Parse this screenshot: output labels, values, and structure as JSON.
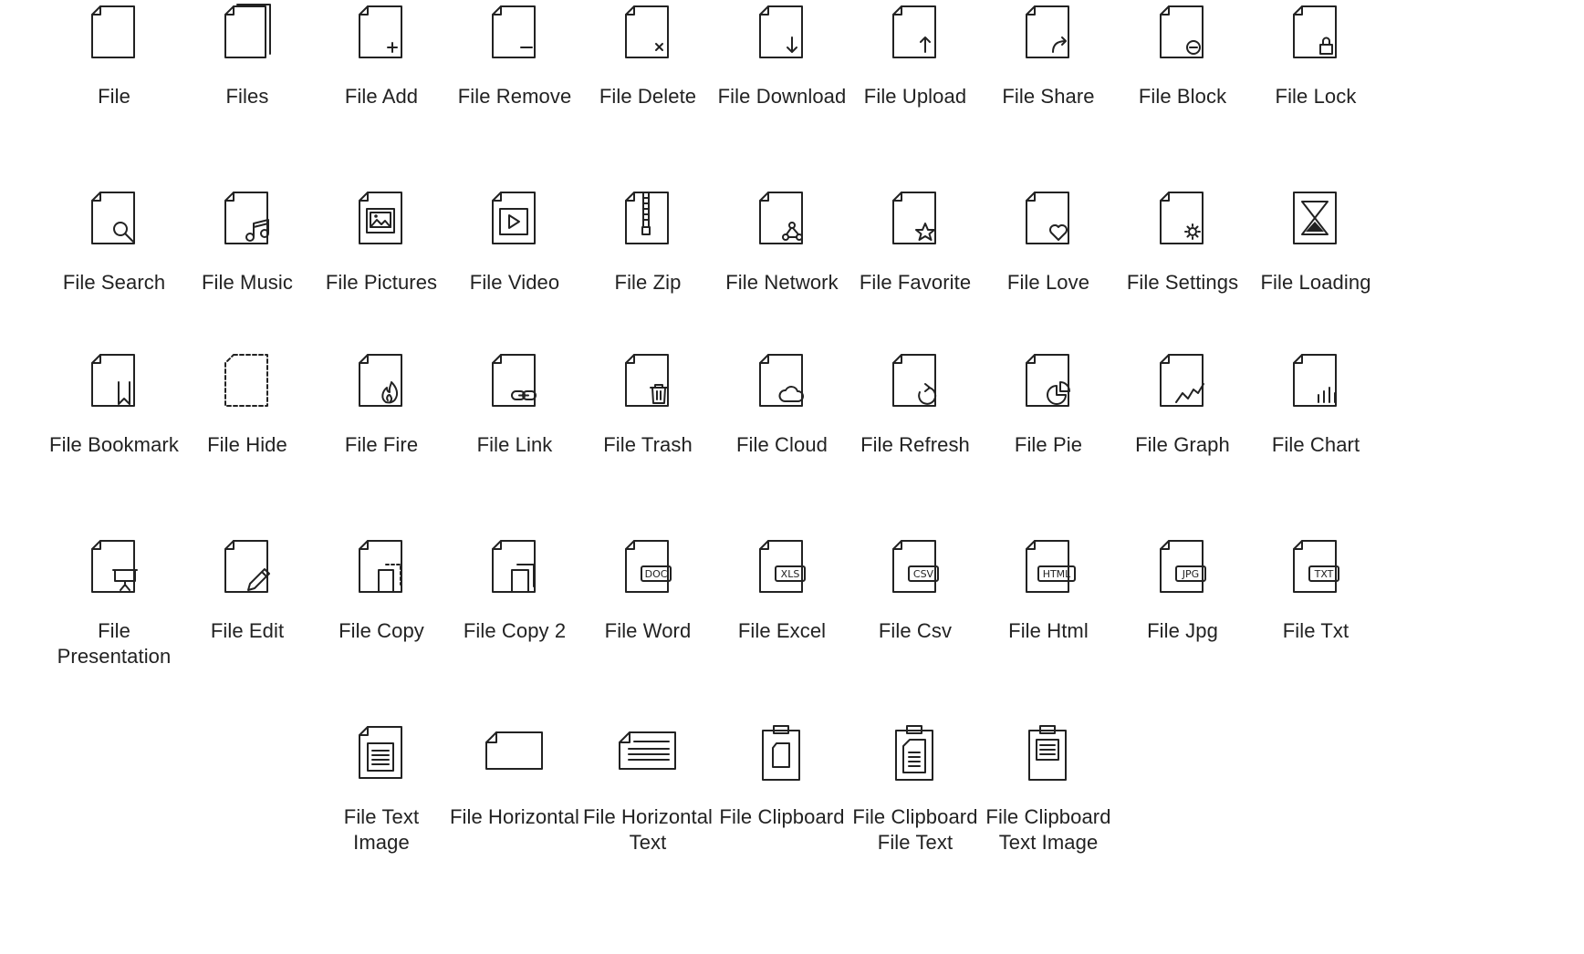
{
  "colors": {
    "ink": "#222222",
    "background": "#ffffff"
  },
  "rows": [
    {
      "items": [
        {
          "icon": "file-icon",
          "label": "File"
        },
        {
          "icon": "files-icon",
          "label": "Files"
        },
        {
          "icon": "file-add-icon",
          "label": "File Add"
        },
        {
          "icon": "file-remove-icon",
          "label": "File Remove"
        },
        {
          "icon": "file-delete-icon",
          "label": "File Delete"
        },
        {
          "icon": "file-download-icon",
          "label": "File Download"
        },
        {
          "icon": "file-upload-icon",
          "label": "File Upload"
        },
        {
          "icon": "file-share-icon",
          "label": "File Share"
        },
        {
          "icon": "file-block-icon",
          "label": "File Block"
        },
        {
          "icon": "file-lock-icon",
          "label": "File Lock"
        }
      ]
    },
    {
      "items": [
        {
          "icon": "file-search-icon",
          "label": "File Search"
        },
        {
          "icon": "file-music-icon",
          "label": "File Music"
        },
        {
          "icon": "file-pictures-icon",
          "label": "File Pictures"
        },
        {
          "icon": "file-video-icon",
          "label": "File Video"
        },
        {
          "icon": "file-zip-icon",
          "label": "File Zip"
        },
        {
          "icon": "file-network-icon",
          "label": "File Network"
        },
        {
          "icon": "file-favorite-icon",
          "label": "File Favorite"
        },
        {
          "icon": "file-love-icon",
          "label": "File Love"
        },
        {
          "icon": "file-settings-icon",
          "label": "File Settings"
        },
        {
          "icon": "file-loading-icon",
          "label": "File Loading"
        }
      ]
    },
    {
      "items": [
        {
          "icon": "file-bookmark-icon",
          "label": "File Bookmark"
        },
        {
          "icon": "file-hide-icon",
          "label": "File Hide"
        },
        {
          "icon": "file-fire-icon",
          "label": "File Fire"
        },
        {
          "icon": "file-link-icon",
          "label": "File Link"
        },
        {
          "icon": "file-trash-icon",
          "label": "File Trash"
        },
        {
          "icon": "file-cloud-icon",
          "label": "File Cloud"
        },
        {
          "icon": "file-refresh-icon",
          "label": "File Refresh"
        },
        {
          "icon": "file-pie-icon",
          "label": "File Pie"
        },
        {
          "icon": "file-graph-icon",
          "label": "File Graph"
        },
        {
          "icon": "file-chart-icon",
          "label": "File Chart"
        }
      ]
    },
    {
      "items": [
        {
          "icon": "file-presentation-icon",
          "label": "File Presentation"
        },
        {
          "icon": "file-edit-icon",
          "label": "File Edit"
        },
        {
          "icon": "file-copy-icon",
          "label": "File Copy"
        },
        {
          "icon": "file-copy-2-icon",
          "label": "File Copy 2"
        },
        {
          "icon": "file-word-icon",
          "label": "File Word",
          "badge": "DOC"
        },
        {
          "icon": "file-excel-icon",
          "label": "File Excel",
          "badge": "XLS"
        },
        {
          "icon": "file-csv-icon",
          "label": "File Csv",
          "badge": "CSV"
        },
        {
          "icon": "file-html-icon",
          "label": "File Html",
          "badge": "HTML"
        },
        {
          "icon": "file-jpg-icon",
          "label": "File Jpg",
          "badge": "JPG"
        },
        {
          "icon": "file-txt-icon",
          "label": "File Txt",
          "badge": "TXT"
        }
      ]
    },
    {
      "items": [
        {
          "icon": "file-text-image-icon",
          "label": "File Text Image"
        },
        {
          "icon": "file-horizontal-icon",
          "label": "File Horizontal"
        },
        {
          "icon": "file-horizontal-text-icon",
          "label": "File Horizontal Text"
        },
        {
          "icon": "file-clipboard-icon",
          "label": "File Clipboard"
        },
        {
          "icon": "file-clipboard-file-text-icon",
          "label": "File Clipboard File Text"
        },
        {
          "icon": "file-clipboard-text-image-icon",
          "label": "File Clipboard Text Image"
        }
      ]
    }
  ]
}
